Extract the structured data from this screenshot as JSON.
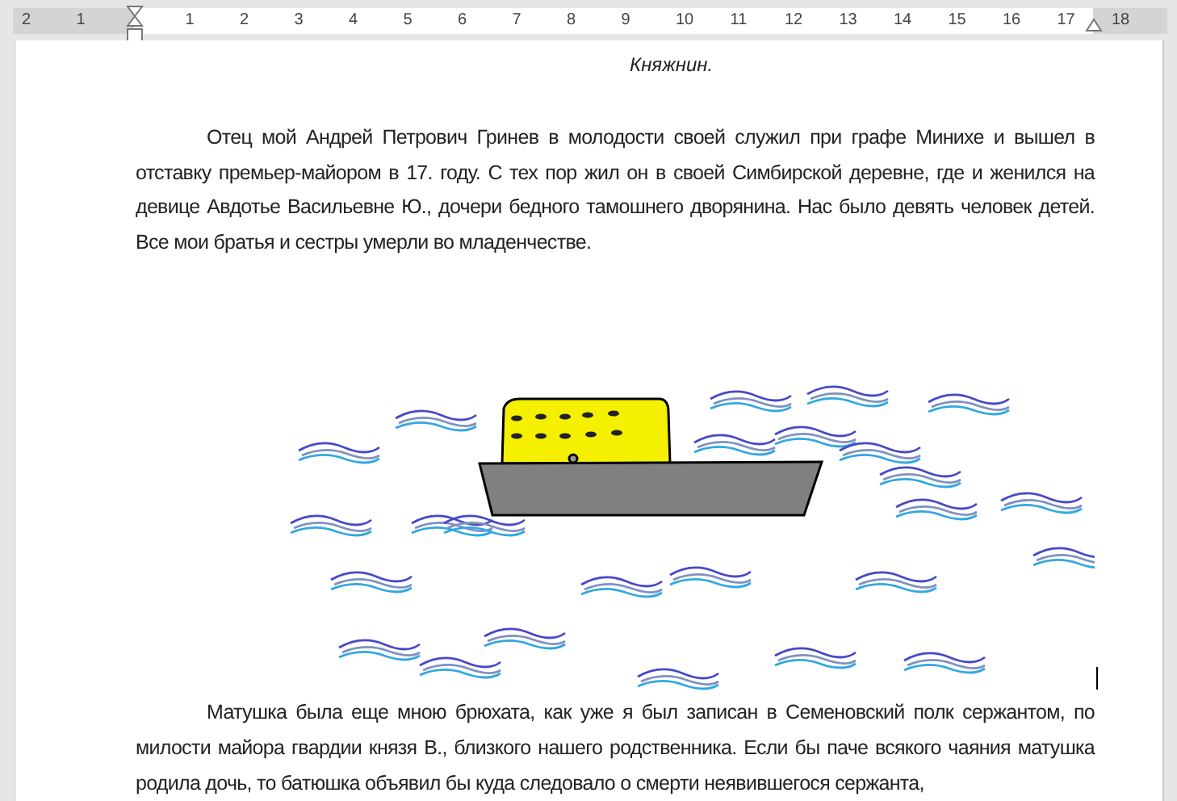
{
  "ruler": {
    "left_labels": [
      "2",
      "1"
    ],
    "right_labels": [
      "1",
      "2",
      "3",
      "4",
      "5",
      "6",
      "7",
      "8",
      "9",
      "10",
      "11",
      "12",
      "13",
      "14",
      "15",
      "16",
      "17",
      "18"
    ]
  },
  "document": {
    "blocks": [
      {
        "kind": "epigraph",
        "text": "Княжнин."
      },
      {
        "kind": "paragraph",
        "text": "Отец мой Андрей Петрович Гринев в молодости своей служил при графе Минихе и вышел в отставку премьер-майором в 17. году. С тех пор жил он в своей Симбирской деревне, где и женился на девице Авдотье Васильевне Ю., дочери бедного тамошнего дворянина. Нас было девять человек детей. Все мои братья и сестры умерли во младенчестве."
      },
      {
        "kind": "drawing"
      },
      {
        "kind": "paragraph",
        "text": "Матушка была еще мною брюхата, как уже я был записан в Семеновский полк сержантом, по милости майора гвардии князя В., близкого нашего родственника. Если бы паче всякого чаяния матушка родила дочь, то батюшка объявил бы куда следовало о смерти неявившегося сержанта,"
      }
    ]
  }
}
